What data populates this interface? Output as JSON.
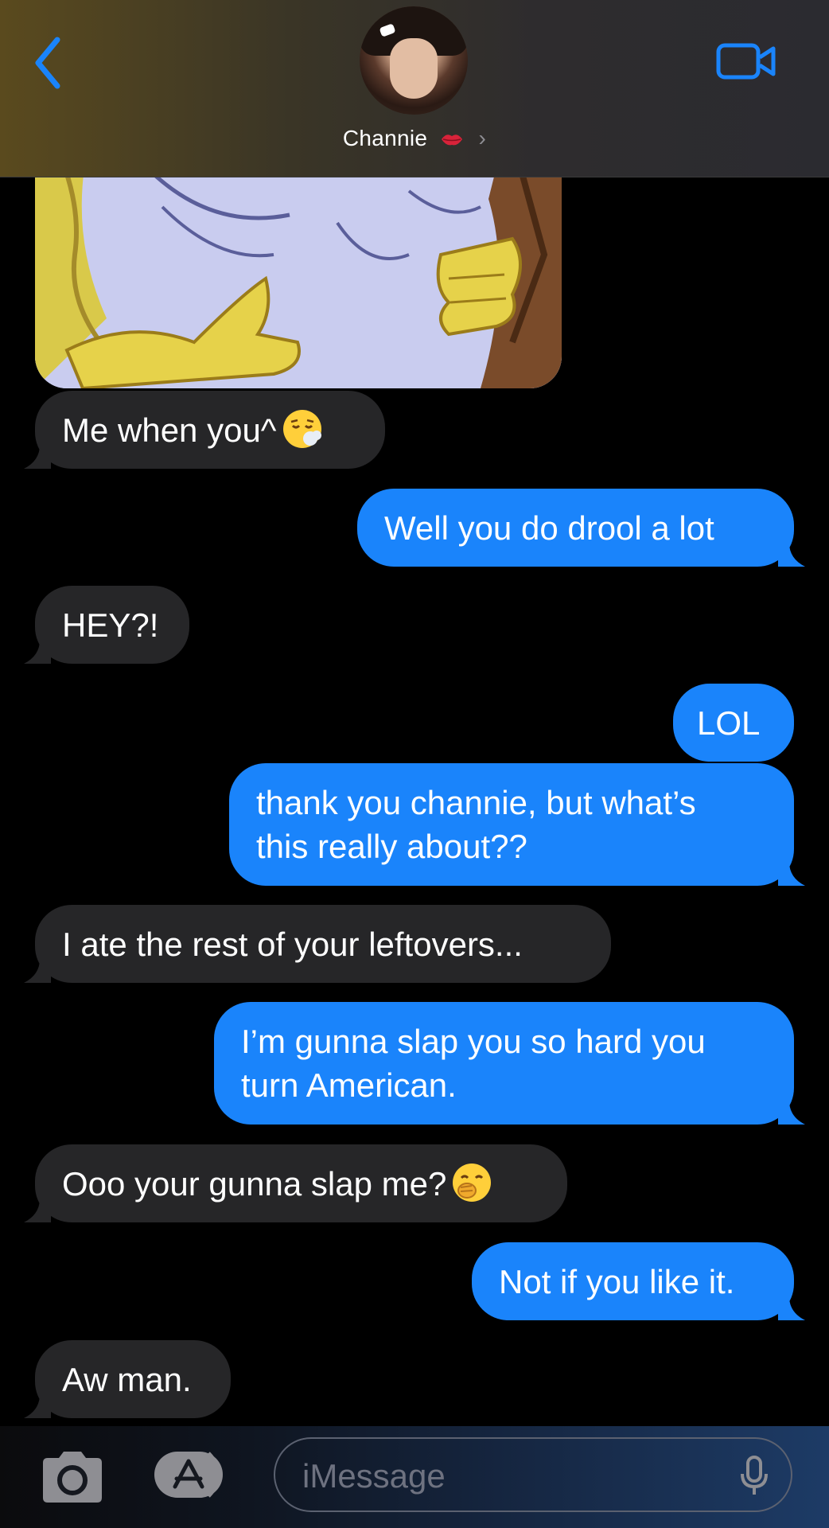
{
  "header": {
    "contact_name": "Channie",
    "contact_badge_icon": "kiss-mark-icon",
    "back_icon": "chevron-left-icon",
    "video_icon": "video-camera-icon",
    "accent_color": "#1a84fb"
  },
  "messages": [
    {
      "from": "them",
      "type": "image",
      "image": "cartoon-meme"
    },
    {
      "from": "them",
      "text": "Me when you^",
      "emoji": "face-exhaling"
    },
    {
      "from": "me",
      "text": "Well you do drool a lot"
    },
    {
      "from": "them",
      "text": "HEY?!"
    },
    {
      "from": "me",
      "text": "LOL"
    },
    {
      "from": "me",
      "line1": "thank you channie, but what’s",
      "line2": "this really about??"
    },
    {
      "from": "them",
      "text": "I ate the rest of your leftovers..."
    },
    {
      "from": "me",
      "line1": "I’m gunna slap you so hard you",
      "line2": "turn American."
    },
    {
      "from": "them",
      "text": "Ooo your gunna slap me?",
      "emoji": "face-with-hand-over-mouth"
    },
    {
      "from": "me",
      "text": "Not if you like it."
    },
    {
      "from": "them",
      "text": "Aw man."
    }
  ],
  "compose": {
    "placeholder": "iMessage",
    "camera_icon": "camera-icon",
    "apps_icon": "app-store-icon",
    "mic_icon": "microphone-icon"
  },
  "colors": {
    "incoming_bubble": "#262628",
    "outgoing_bubble": "#1a84fb",
    "background": "#000000"
  }
}
